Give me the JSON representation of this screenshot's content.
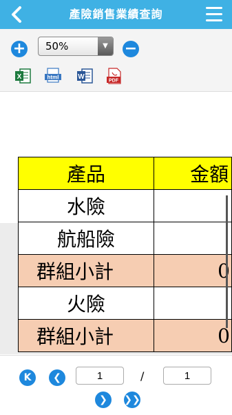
{
  "header": {
    "title": "產險銷售業績查詢"
  },
  "toolbar": {
    "zoom_value": "50%",
    "export_icons": [
      "excel-icon",
      "html-icon",
      "word-icon",
      "pdf-icon"
    ],
    "excel_label": "X",
    "html_label": "html",
    "word_label": "W",
    "pdf_label": "PDF"
  },
  "report": {
    "columns": [
      "產品",
      "金額"
    ],
    "rows": [
      {
        "product": "水險",
        "amount": ""
      },
      {
        "product": "航船險",
        "amount": ""
      },
      {
        "product": "群組小計",
        "amount": "0"
      },
      {
        "product": "火險",
        "amount": ""
      },
      {
        "product": "群組小計",
        "amount": "0"
      }
    ]
  },
  "pager": {
    "current_page": "1",
    "separator": "/",
    "total_pages": "1"
  },
  "colors": {
    "accent": "#3fb1e4",
    "button_blue": "#1e88dd",
    "header_yellow": "#ffff00",
    "subtotal_peach": "#f6cdb2"
  }
}
